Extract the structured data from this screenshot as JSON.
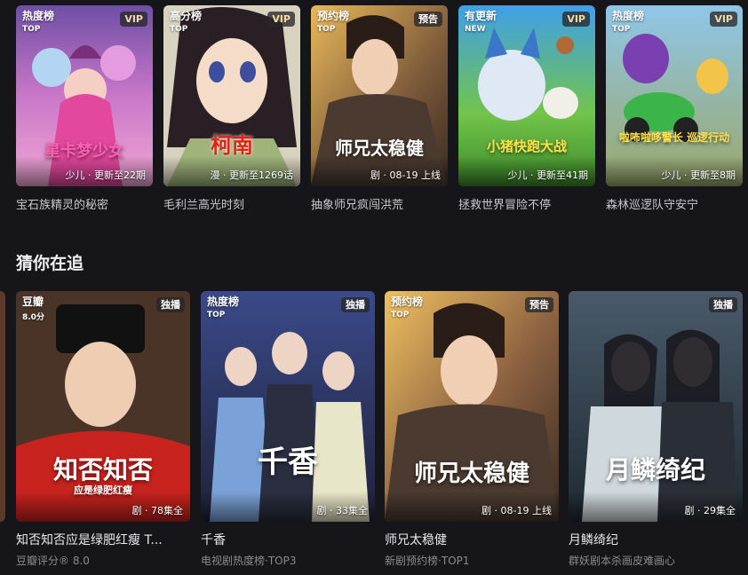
{
  "top_row": [
    {
      "rank": "热度榜",
      "rank_sub": "TOP",
      "badge": "VIP",
      "status": "少儿 · 更新至22期",
      "caption": "宝石族精灵的秘密",
      "logo": "星卡梦少女"
    },
    {
      "rank": "高分榜",
      "rank_sub": "TOP",
      "badge": "VIP",
      "status": "漫 · 更新至1269话",
      "caption": "毛利兰高光时刻",
      "logo": "柯南"
    },
    {
      "rank": "预约榜",
      "rank_sub": "TOP",
      "badge": "预告",
      "status": "剧 · 08-19 上线",
      "caption": "抽象师兄疯闯洪荒",
      "logo": "师兄太稳健"
    },
    {
      "rank": "有更新",
      "rank_sub": "NEW",
      "badge": "VIP",
      "status": "少儿 · 更新至41期",
      "caption": "拯救世界冒险不停",
      "logo": "小猪快跑大战"
    },
    {
      "rank": "热度榜",
      "rank_sub": "TOP",
      "badge": "VIP",
      "status": "少儿 · 更新至8期",
      "caption": "森林巡逻队守安宁",
      "logo": "啦咘啦哆警长 巡逻行动"
    }
  ],
  "section": {
    "title": "猜你在追"
  },
  "bottom_row": [
    {
      "rank": "豆瓣",
      "rank_sub": "8.0分",
      "badge": "独播",
      "status": "剧 · 78集全",
      "title": "知否知否应是绿肥红瘦 T...",
      "subtitle": "豆瓣评分® 8.0",
      "logo": "知否知否",
      "logo_sub": "应是绿肥红瘦"
    },
    {
      "rank": "热度榜",
      "rank_sub": "TOP",
      "badge": "独播",
      "status": "剧 · 33集全",
      "title": "千香",
      "subtitle": "电视剧热度榜·TOP3",
      "logo": "千香",
      "logo_sub": ""
    },
    {
      "rank": "预约榜",
      "rank_sub": "TOP",
      "badge": "预告",
      "status": "剧 · 08-19 上线",
      "title": "师兄太稳健",
      "subtitle": "新剧预约榜·TOP1",
      "logo": "师兄太稳健",
      "logo_sub": ""
    },
    {
      "rank": "",
      "rank_sub": "",
      "badge": "独播",
      "status": "剧 · 29集全",
      "title": "月鳞绮纪",
      "subtitle": "群妖剧本杀画皮难画心",
      "logo": "月鳞绮纪",
      "logo_sub": ""
    }
  ]
}
